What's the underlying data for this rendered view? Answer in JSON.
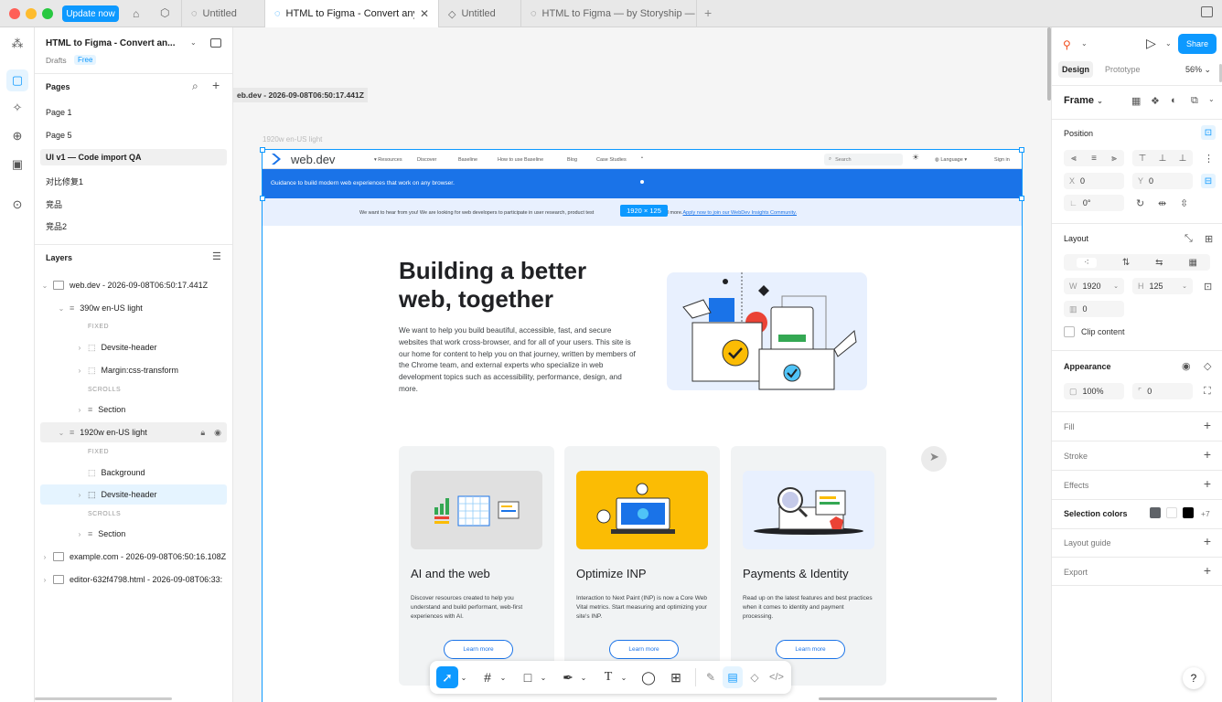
{
  "titlebar": {
    "update_label": "Update now",
    "tabs": [
      {
        "label": "Untitled"
      },
      {
        "label": "HTML to Figma - Convert any we"
      },
      {
        "label": "Untitled"
      },
      {
        "label": "HTML to Figma — by Storyship — Im;"
      }
    ]
  },
  "file": {
    "name": "HTML to Figma - Convert an...",
    "drafts": "Drafts",
    "plan": "Free"
  },
  "pages": {
    "header": "Pages",
    "items": [
      "Page 1",
      "Page 5",
      "UI v1 — Code import QA",
      "对比修复1",
      "竞品",
      "竞品2"
    ]
  },
  "layers": {
    "header": "Layers",
    "root": "web.dev - 2026-09-08T06:50:17.441Z",
    "frame390": "390w en-US light",
    "fixed1": "FIXED",
    "devsite1": "Devsite-header",
    "margin": "Margin:css-transform",
    "scrolls1": "SCROLLS",
    "section1": "Section",
    "frame1920": "1920w en-US light",
    "fixed2": "FIXED",
    "background": "Background",
    "devsite2": "Devsite-header",
    "scrolls2": "SCROLLS",
    "section2": "Section",
    "example": "example.com - 2026-09-08T06:50:16.108Z",
    "editor": "editor-632f4798.html - 2026-09-08T06:33:"
  },
  "canvas": {
    "frame_label": "eb.dev - 2026-09-08T06:50:17.441Z",
    "sub_label": "1920w en-US light",
    "size_badge": "1920 × 125"
  },
  "webpage": {
    "logo": "web.dev",
    "nav": [
      "Resources",
      "Discover",
      "Baseline",
      "How to use Baseline",
      "Blog",
      "Case Studies"
    ],
    "search": "Search",
    "language": "Language",
    "signin": "Sign in",
    "banner": "Guidance to build modern web experiences that work on any browser.",
    "notice": "We want to hear from you! We are looking for web developers to participate in user research, product test",
    "notice_tail": "ups and more.",
    "notice_link": "Apply now to join our WebDev Insights Community.",
    "hero_title_1": "Building a better",
    "hero_title_2": "web, together",
    "hero_body": "We want to help you build beautiful, accessible, fast, and secure websites that work cross-browser, and for all of your users. This site is our home for content to help you on that journey, written by members of the Chrome team, and external experts who specialize in web development topics such as accessibility, performance, design, and more.",
    "cards": [
      {
        "title": "AI and the web",
        "body": "Discover resources created to help you understand and build performant, web-first experiences with AI.",
        "button": "Learn more"
      },
      {
        "title": "Optimize INP",
        "body": "Interaction to Next Paint (INP) is now a Core Web Vital metrics. Start measuring and optimizing your site's INP.",
        "button": "Learn more"
      },
      {
        "title": "Payments & Identity",
        "body": "Read up on the latest features and best practices when it comes to identity and payment processing.",
        "button": "Learn more"
      }
    ]
  },
  "right": {
    "share": "Share",
    "tab_design": "Design",
    "tab_prototype": "Prototype",
    "zoom": "56%",
    "frame": "Frame",
    "position": "Position",
    "x_label": "X",
    "x_value": "0",
    "y_label": "Y",
    "y_value": "0",
    "rotation": "0°",
    "layout": "Layout",
    "w_label": "W",
    "w_value": "1920",
    "h_label": "H",
    "h_value": "125",
    "gap_value": "0",
    "clip": "Clip content",
    "appearance": "Appearance",
    "opacity": "100%",
    "radius": "0",
    "fill": "Fill",
    "stroke": "Stroke",
    "effects": "Effects",
    "selection_colors": "Selection colors",
    "more_colors": "+7",
    "layout_guide": "Layout guide",
    "export": "Export",
    "help": "?"
  },
  "colors": {
    "accent": "#0d99ff",
    "banner": "#1a73e8",
    "card_yellow": "#fbbc04",
    "card_blue": "#e8f0fe"
  }
}
